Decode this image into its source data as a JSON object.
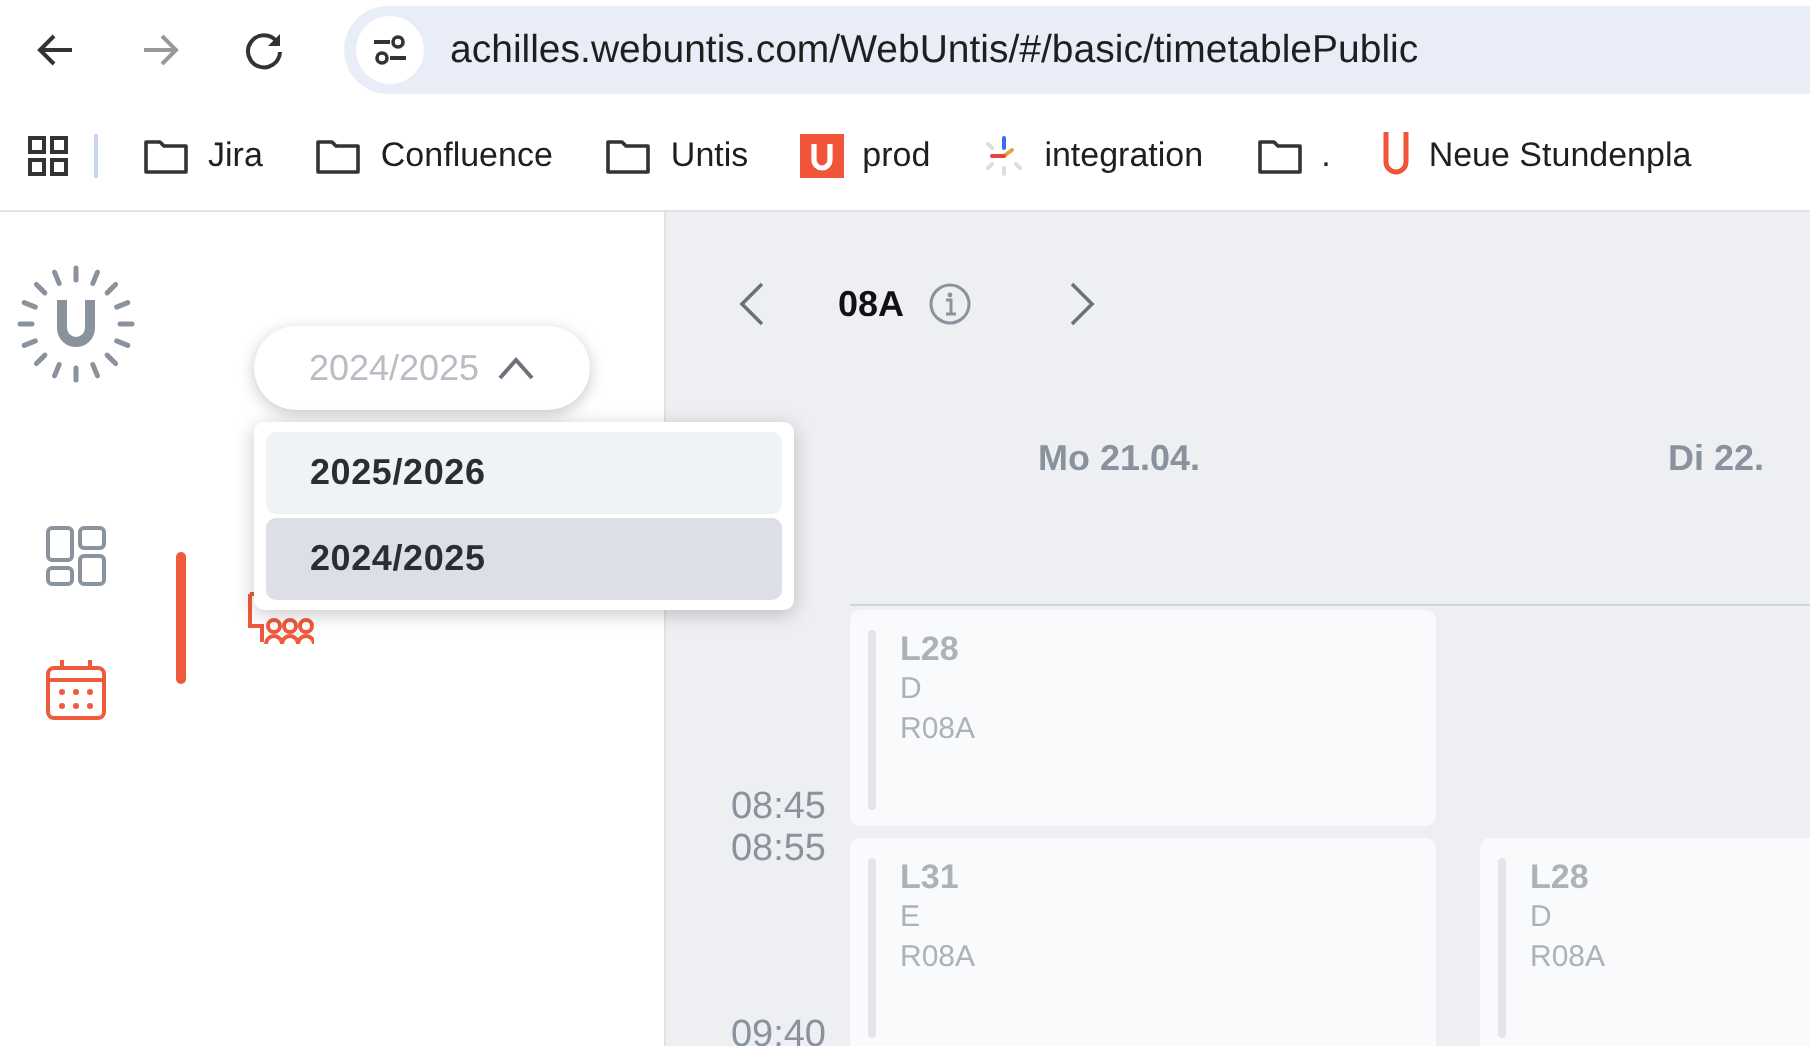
{
  "browser": {
    "url": "achilles.webuntis.com/WebUntis/#/basic/timetablePublic",
    "bookmarks": [
      {
        "label": "Jira",
        "kind": "folder"
      },
      {
        "label": "Confluence",
        "kind": "folder"
      },
      {
        "label": "Untis",
        "kind": "folder"
      },
      {
        "label": "prod",
        "kind": "untis"
      },
      {
        "label": "integration",
        "kind": "spinner"
      },
      {
        "label": ".",
        "kind": "folder"
      },
      {
        "label": "Neue Stundenpla",
        "kind": "ulogo"
      }
    ]
  },
  "rail": {
    "items": [
      {
        "kind": "dashboard",
        "selected": false
      },
      {
        "kind": "calendar",
        "selected": true
      }
    ]
  },
  "nav": {
    "items": [
      {
        "selected": true
      }
    ]
  },
  "year_picker": {
    "value": "2024/2025",
    "expanded": true,
    "options": [
      {
        "label": "2025/2026",
        "selected": false
      },
      {
        "label": "2024/2025",
        "selected": true
      }
    ]
  },
  "timetable": {
    "element": "08A",
    "periods": [
      {
        "end": "08:45"
      },
      {
        "start": "08:55",
        "end": "09:40"
      }
    ],
    "days": [
      {
        "label": "Mo 21.04.",
        "lessons": [
          {
            "kind": "lesson",
            "teacher": "L28",
            "subject": "D",
            "room": "R08A"
          },
          {
            "kind": "lesson",
            "teacher": "L31",
            "subject": "E",
            "room": "R08A"
          }
        ]
      },
      {
        "label": "Di 22.",
        "lessons": [
          {
            "kind": "empty"
          },
          {
            "kind": "lesson",
            "teacher": "L28",
            "subject": "D",
            "room": "R08A"
          }
        ]
      }
    ]
  }
}
